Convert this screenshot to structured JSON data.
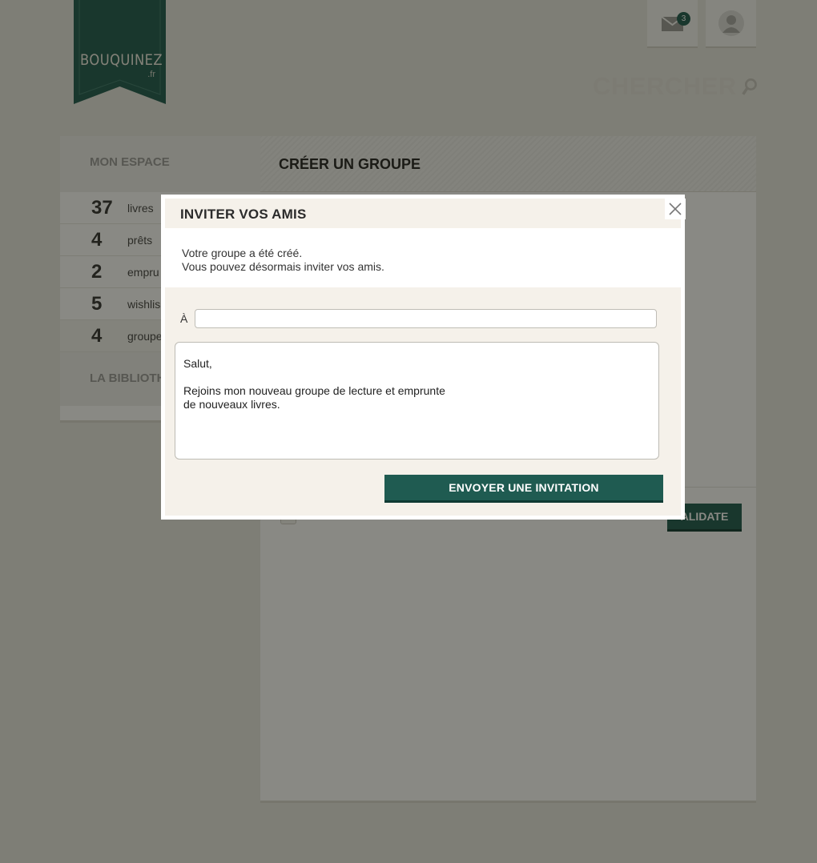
{
  "brand": {
    "logo_text": "BOUQUINEZ",
    "logo_suffix": ".fr",
    "accent": "#1f5b51"
  },
  "header": {
    "mail_badge_count": "3",
    "search_label": "CHERCHER",
    "icons": [
      "envelope-icon",
      "user-icon",
      "search-icon"
    ]
  },
  "sidebar": {
    "heading": "MON ESPACE",
    "stats": [
      {
        "value": "37",
        "label": "livres"
      },
      {
        "value": "4",
        "label": "prêts"
      },
      {
        "value": "2",
        "label": "empru"
      },
      {
        "value": "5",
        "label": "wishlis"
      },
      {
        "value": "4",
        "label": "groupe"
      }
    ],
    "heading2": "LA BIBLIOTH"
  },
  "main": {
    "title": "CRÉER UN GROUPE",
    "validate_label": "ALIDATE"
  },
  "modal": {
    "title": "INVITER VOS AMIS",
    "message_line1": "Votre groupe a été créé.",
    "message_line2": "Vous pouvez désormais inviter vos amis.",
    "to_label": "À",
    "to_value": "",
    "invitation_text": "Salut,\n\nRejoins mon nouveau groupe de lecture et emprunte\nde nouveaux livres.",
    "send_label": "ENVOYER UNE INVITATION"
  }
}
